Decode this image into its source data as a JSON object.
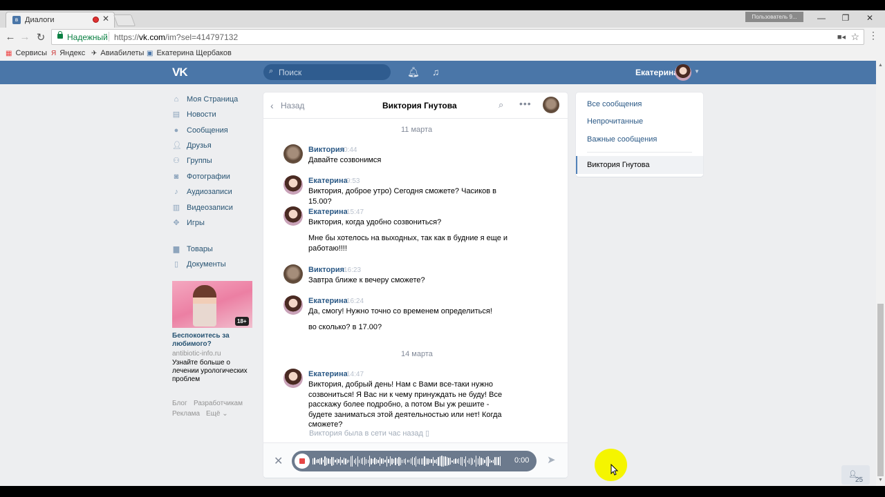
{
  "browser": {
    "tab_title": "Диалоги",
    "profile_label": "Пользователь 9...",
    "secure_label": "Надежный",
    "url_prefix": "https://",
    "url_host": "vk.com",
    "url_path": "/im?sel=414797132",
    "bookmarks": [
      "Сервисы",
      "Яндекс",
      "Авиабилеты",
      "Екатерина Щербаков"
    ]
  },
  "header": {
    "logo": "VK",
    "search_placeholder": "Поиск",
    "user_name": "Екатерина"
  },
  "left_nav": {
    "items": [
      {
        "label": "Моя Страница",
        "icon": "home-icon"
      },
      {
        "label": "Новости",
        "icon": "news-icon"
      },
      {
        "label": "Сообщения",
        "icon": "messages-icon"
      },
      {
        "label": "Друзья",
        "icon": "friends-icon"
      },
      {
        "label": "Группы",
        "icon": "groups-icon"
      },
      {
        "label": "Фотографии",
        "icon": "camera-icon"
      },
      {
        "label": "Аудиозаписи",
        "icon": "music-icon"
      },
      {
        "label": "Видеозаписи",
        "icon": "video-icon"
      },
      {
        "label": "Игры",
        "icon": "gamepad-icon"
      },
      {
        "label": "Товары",
        "icon": "shopping-bag-icon"
      },
      {
        "label": "Документы",
        "icon": "document-icon"
      }
    ]
  },
  "ad": {
    "age_badge": "18+",
    "title": "Беспокоитесь за любимого?",
    "domain": "antibiotic-info.ru",
    "text": "Узнайте больше о лечении урологических проблем"
  },
  "footer": {
    "links": [
      "Блог",
      "Разработчикам",
      "Реклама",
      "Ещё ⌄"
    ]
  },
  "chat": {
    "back_label": "Назад",
    "title": "Виктория Гнутова",
    "date1": "11 марта",
    "date2": "14 марта",
    "messages": [
      {
        "author": "Виктория",
        "time": "0:44",
        "text": "Давайте созвонимся"
      },
      {
        "author": "Екатерина",
        "time": "9:53",
        "text": "Виктория, доброе утро) Сегодня сможете? Часиков в 15.00?"
      },
      {
        "author": "Екатерина",
        "time": "15:47",
        "text": "Виктория, когда удобно созвониться?",
        "text2": "Мне бы хотелось на выходных, так как в будние я еще и работаю!!!!"
      },
      {
        "author": "Виктория",
        "time": "16:23",
        "text": "Завтра ближе к вечеру сможете?"
      },
      {
        "author": "Екатерина",
        "time": "16:24",
        "text": "Да, смогу! Нужно точно со временем определиться!",
        "text2": "во сколько? в 17.00?"
      },
      {
        "author": "Екатерина",
        "time": "14:47",
        "text": "Виктория, добрый день! Нам с Вами все-таки нужно созвониться! Я Вас ни к чему принуждать не буду! Все расскажу более подробно, а потом Вы уж решите - будете заниматься этой деятельностью или нет! Когда сможете?"
      }
    ],
    "seen_status": "Виктория была в сети час назад",
    "recording_time": "0:00"
  },
  "right_panel": {
    "items": [
      "Все сообщения",
      "Непрочитанные",
      "Важные сообщения"
    ],
    "active": "Виктория Гнутова"
  },
  "people_count": "25",
  "colors": {
    "vk_blue": "#4a76a8",
    "link": "#2a5885",
    "page_bg": "#edeef0",
    "record_red": "#e64646",
    "cursor_highlight": "#f5f500"
  }
}
